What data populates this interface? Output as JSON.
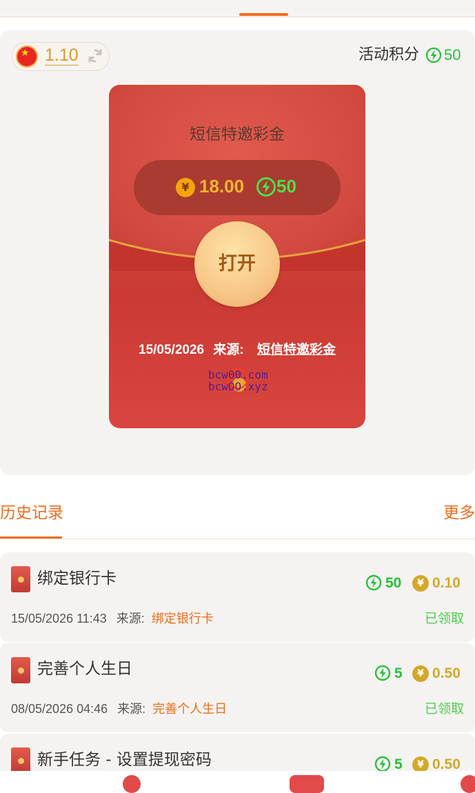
{
  "header": {},
  "wallet": {
    "balance": "1.10",
    "points_label": "活动积分",
    "points_value": "50"
  },
  "envelope": {
    "title": "短信特邀彩金",
    "currency_symbol": "¥",
    "amount": "18.00",
    "points": "50",
    "open_label": "打开",
    "date": "15/05/2026",
    "source_label": "来源:",
    "source_value": "短信特邀彩金",
    "watermark_line1": "bcw00.com",
    "watermark_line2": "bcwOO.xyz"
  },
  "history": {
    "tab_label": "历史记录",
    "more_label": "更多",
    "records": [
      {
        "title": "绑定银行卡",
        "points": "50",
        "amount": "0.10",
        "datetime": "15/05/2026 11:43",
        "source_label": "来源:",
        "source": "绑定银行卡",
        "status": "已领取"
      },
      {
        "title": "完善个人生日",
        "points": "5",
        "amount": "0.50",
        "datetime": "08/05/2026 04:46",
        "source_label": "来源:",
        "source": "完善个人生日",
        "status": "已领取"
      },
      {
        "title": "新手任务 - 设置提现密码",
        "points": "5",
        "amount": "0.50"
      }
    ]
  },
  "colors": {
    "accent": "#ef6c1a",
    "points_green": "#27c13a",
    "gold": "#d4a82a",
    "envelope_red": "#d84a3f"
  },
  "icons": [
    "china-flag-icon",
    "refresh-icon",
    "lightning-icon",
    "yuan-coin-icon",
    "red-envelope-icon"
  ]
}
